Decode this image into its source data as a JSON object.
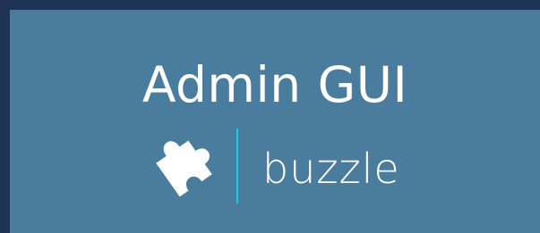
{
  "header": {
    "title": "Admin GUI"
  },
  "logo": {
    "wordmark": "buzzle",
    "icon": "puzzle-piece-icon",
    "divider_color": "#1ec8e8"
  },
  "colors": {
    "frame": "#1f3355",
    "panel": "#4a7c9e",
    "text": "#ffffff"
  }
}
